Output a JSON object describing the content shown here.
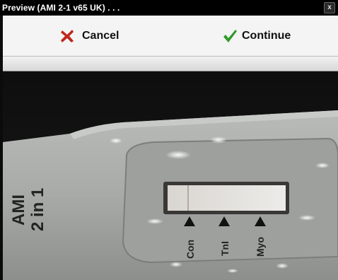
{
  "window": {
    "title": "Preview (AMI 2-1 v65 UK) . . .",
    "close_glyph": "x"
  },
  "toolbar": {
    "cancel_label": "Cancel",
    "continue_label": "Continue",
    "cancel_icon": "red-x-icon",
    "continue_icon": "green-checkmark-icon"
  },
  "preview": {
    "device_label_line1": "AMI",
    "device_label_line2": "2 in 1",
    "markers": [
      "Con",
      "TnI",
      "Myo"
    ]
  },
  "colors": {
    "cancel_red": "#c0271d",
    "continue_green": "#2f9a26",
    "titlebar": "#000000",
    "toolbar": "#f4f4f4"
  }
}
